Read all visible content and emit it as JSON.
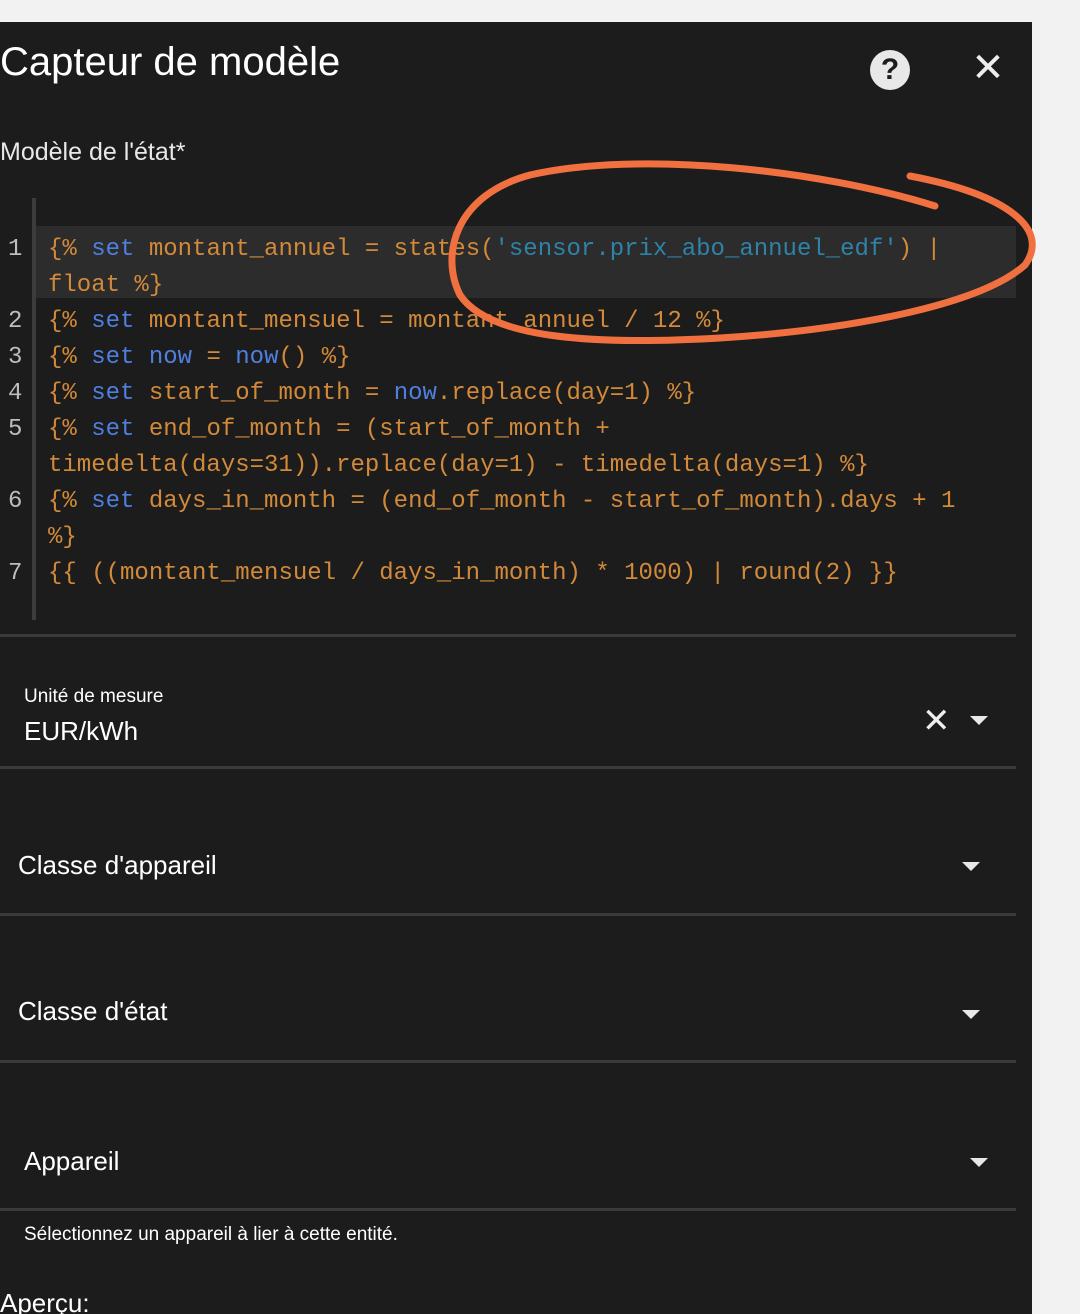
{
  "dialog": {
    "title": "Capteur de modèle"
  },
  "state_template": {
    "label": "Modèle de l'état*",
    "line_numbers": [
      "1",
      "2",
      "3",
      "4",
      "5",
      "6",
      "7"
    ],
    "lines": [
      {
        "n": "1",
        "parts": [
          [
            "o",
            "{% "
          ],
          [
            "k",
            "set"
          ],
          [
            "o",
            " montant_annuel = states("
          ],
          [
            "s",
            "'sensor.prix_abo_annuel_edf'"
          ],
          [
            "o",
            ") |"
          ]
        ]
      },
      {
        "n": "",
        "parts": [
          [
            "o",
            "float %}"
          ]
        ]
      },
      {
        "n": "2",
        "parts": [
          [
            "o",
            "{% "
          ],
          [
            "k",
            "set"
          ],
          [
            "o",
            " montant_mensuel = montant_annuel / 12 %}"
          ]
        ]
      },
      {
        "n": "3",
        "parts": [
          [
            "o",
            "{% "
          ],
          [
            "k",
            "set"
          ],
          [
            "o",
            " "
          ],
          [
            "k",
            "now"
          ],
          [
            "o",
            " = "
          ],
          [
            "k",
            "now"
          ],
          [
            "o",
            "() %}"
          ]
        ]
      },
      {
        "n": "4",
        "parts": [
          [
            "o",
            "{% "
          ],
          [
            "k",
            "set"
          ],
          [
            "o",
            " start_of_month = "
          ],
          [
            "k",
            "now"
          ],
          [
            "o",
            ".replace(day=1) %}"
          ]
        ]
      },
      {
        "n": "5",
        "parts": [
          [
            "o",
            "{% "
          ],
          [
            "k",
            "set"
          ],
          [
            "o",
            " end_of_month = (start_of_month +"
          ]
        ]
      },
      {
        "n": "",
        "parts": [
          [
            "o",
            "timedelta(days=31)).replace(day=1) - timedelta(days=1) %}"
          ]
        ]
      },
      {
        "n": "6",
        "parts": [
          [
            "o",
            "{% "
          ],
          [
            "k",
            "set"
          ],
          [
            "o",
            " days_in_month = (end_of_month - start_of_month).days + 1"
          ]
        ]
      },
      {
        "n": "",
        "parts": [
          [
            "o",
            "%}"
          ]
        ]
      },
      {
        "n": "7",
        "parts": [
          [
            "o",
            "{{ ((montant_mensuel / days_in_month) * 1000) | round(2) }}"
          ]
        ]
      }
    ]
  },
  "unit": {
    "label": "Unité de mesure",
    "value": "EUR/kWh"
  },
  "device_class": {
    "label": "Classe d'appareil"
  },
  "state_class": {
    "label": "Classe d'état"
  },
  "device": {
    "label": "Appareil",
    "helper": "Sélectionnez un appareil à lier à cette entité."
  },
  "preview": {
    "label": "Aperçu:"
  },
  "colors": {
    "background": "#1c1c1c",
    "code_orange": "#d28a3a",
    "code_keyword": "#4f7fe0",
    "code_string": "#2f82a8",
    "annotation": "#f07040"
  }
}
